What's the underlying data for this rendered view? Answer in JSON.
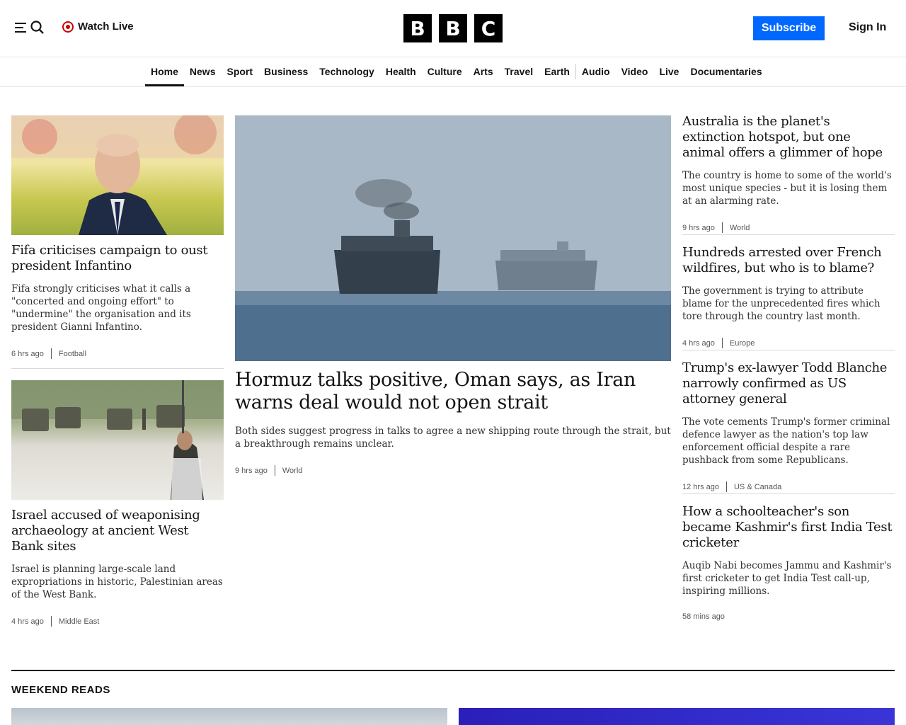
{
  "header": {
    "watch_live": "Watch Live",
    "logo_letters": [
      "B",
      "B",
      "C"
    ],
    "subscribe": "Subscribe",
    "sign_in": "Sign In"
  },
  "nav": {
    "items": [
      "Home",
      "News",
      "Sport",
      "Business",
      "Technology",
      "Health",
      "Culture",
      "Arts",
      "Travel",
      "Earth",
      "Audio",
      "Video",
      "Live",
      "Documentaries"
    ],
    "active": "Home"
  },
  "stories": {
    "fifa": {
      "headline": "Fifa criticises campaign to oust president Infantino",
      "summary": "Fifa strongly criticises what it calls a \"concerted and ongoing effort\" to \"undermine\" the organisation and its president Gianni Infantino.",
      "time": "6 hrs ago",
      "section": "Football"
    },
    "israel": {
      "headline": "Israel accused of weaponising archaeology at ancient West Bank sites",
      "summary": "Israel is planning large-scale land expropriations in historic, Palestinian areas of the West Bank.",
      "time": "4 hrs ago",
      "section": "Middle East"
    },
    "hormuz": {
      "headline": "Hormuz talks positive, Oman says, as Iran warns deal would not open strait",
      "summary": "Both sides suggest progress in talks to agree a new shipping route through the strait, but a breakthrough remains unclear.",
      "time": "9 hrs ago",
      "section": "World"
    },
    "australia": {
      "headline": "Australia is the planet's extinction hotspot, but one animal offers a glimmer of hope",
      "summary": "The country is home to some of the world's most unique species - but it is losing them at an alarming rate.",
      "time": "9 hrs ago",
      "section": "World"
    },
    "france": {
      "headline": "Hundreds arrested over French wildfires, but who is to blame?",
      "summary": "The government is trying to attribute blame for the unprecedented fires which tore through the country last month.",
      "time": "4 hrs ago",
      "section": "Europe"
    },
    "blanche": {
      "headline": "Trump's ex-lawyer Todd Blanche narrowly confirmed as US attorney general",
      "summary": "The vote cements Trump's former criminal defence lawyer as the nation's top law enforcement official despite a rare pushback from some Republicans.",
      "time": "12 hrs ago",
      "section": "US & Canada"
    },
    "kashmir": {
      "headline": "How a schoolteacher's son became Kashmir's first India Test cricketer",
      "summary": "Auqib Nabi becomes Jammu and Kashmir's first cricketer to get India Test call-up, inspiring millions.",
      "time": "58 mins ago"
    }
  },
  "weekend_reads": {
    "title": "WEEKEND READS"
  },
  "colors": {
    "accent": "#0068ff",
    "live_red": "#cc0000",
    "text": "#141414"
  }
}
